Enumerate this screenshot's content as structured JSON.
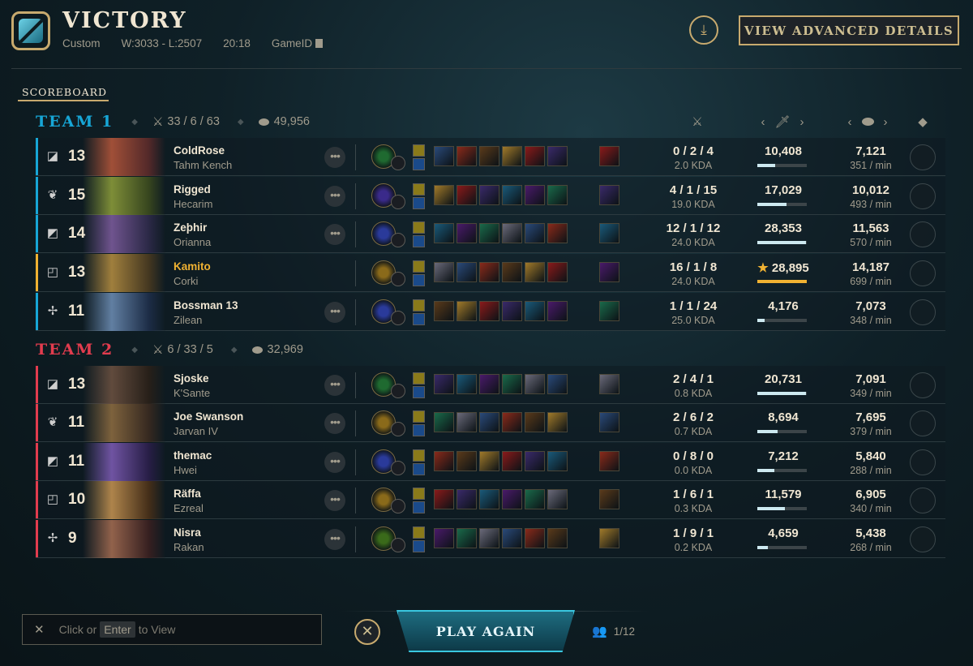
{
  "header": {
    "title": "VICTORY",
    "mode": "Custom",
    "record": "W:3033 - L:2507",
    "duration": "20:18",
    "gameid_label": "GameID",
    "advanced_button": "VIEW ADVANCED DETAILS"
  },
  "scoreboard_label": "SCOREBOARD",
  "teams": [
    {
      "name": "TEAM 1",
      "kills": "33 / 6 / 63",
      "gold": "49,956",
      "color": "#17a6d6",
      "players": [
        {
          "level": "13",
          "name": "ColdRose",
          "champion": "Tahm Kench",
          "kda": "0 / 2 / 4",
          "kda_ratio": "2.0 KDA",
          "damage": "10,408",
          "damage_fill": 0.36,
          "gold": "7,121",
          "gpm": "351 / min",
          "highlight": false,
          "role": "top-icon"
        },
        {
          "level": "15",
          "name": "Rigged",
          "champion": "Hecarim",
          "kda": "4 / 1 / 15",
          "kda_ratio": "19.0 KDA",
          "damage": "17,029",
          "damage_fill": 0.59,
          "gold": "10,012",
          "gpm": "493 / min",
          "highlight": false,
          "role": "jungle-icon"
        },
        {
          "level": "14",
          "name": "Zeþhir",
          "champion": "Orianna",
          "kda": "12 / 1 / 12",
          "kda_ratio": "24.0 KDA",
          "damage": "28,353",
          "damage_fill": 0.98,
          "gold": "11,563",
          "gpm": "570 / min",
          "highlight": false,
          "role": "mid-icon"
        },
        {
          "level": "13",
          "name": "Kamito",
          "champion": "Corki",
          "kda": "16 / 1 / 8",
          "kda_ratio": "24.0 KDA",
          "damage": "28,895",
          "damage_fill": 1.0,
          "gold": "14,187",
          "gpm": "699 / min",
          "highlight": true,
          "role": "bottom-icon"
        },
        {
          "level": "11",
          "name": "Bossman 13",
          "champion": "Zilean",
          "kda": "1 / 1 / 24",
          "kda_ratio": "25.0 KDA",
          "damage": "4,176",
          "damage_fill": 0.15,
          "gold": "7,073",
          "gpm": "348 / min",
          "highlight": false,
          "role": "support-icon"
        }
      ]
    },
    {
      "name": "TEAM 2",
      "kills": "6 / 33 / 5",
      "gold": "32,969",
      "color": "#e23c4e",
      "players": [
        {
          "level": "13",
          "name": "Sjoske",
          "champion": "K'Sante",
          "kda": "2 / 4 / 1",
          "kda_ratio": "0.8 KDA",
          "damage": "20,731",
          "damage_fill": 0.98,
          "gold": "7,091",
          "gpm": "349 / min",
          "highlight": false,
          "role": "top-icon"
        },
        {
          "level": "11",
          "name": "Joe Swanson",
          "champion": "Jarvan IV",
          "kda": "2 / 6 / 2",
          "kda_ratio": "0.7 KDA",
          "damage": "8,694",
          "damage_fill": 0.41,
          "gold": "7,695",
          "gpm": "379 / min",
          "highlight": false,
          "role": "jungle-icon"
        },
        {
          "level": "11",
          "name": "themac",
          "champion": "Hwei",
          "kda": "0 / 8 / 0",
          "kda_ratio": "0.0 KDA",
          "damage": "7,212",
          "damage_fill": 0.34,
          "gold": "5,840",
          "gpm": "288 / min",
          "highlight": false,
          "role": "mid-icon"
        },
        {
          "level": "10",
          "name": "Räffa",
          "champion": "Ezreal",
          "kda": "1 / 6 / 1",
          "kda_ratio": "0.3 KDA",
          "damage": "11,579",
          "damage_fill": 0.55,
          "gold": "6,905",
          "gpm": "340 / min",
          "highlight": false,
          "role": "bottom-icon"
        },
        {
          "level": "9",
          "name": "Nisra",
          "champion": "Rakan",
          "kda": "1 / 9 / 1",
          "kda_ratio": "0.2 KDA",
          "damage": "4,659",
          "damage_fill": 0.22,
          "gold": "5,438",
          "gpm": "268 / min",
          "highlight": false,
          "role": "support-icon"
        }
      ]
    }
  ],
  "footer": {
    "chat_prefix": "Click or",
    "chat_key": "Enter",
    "chat_suffix": "to View",
    "play_again": "PLAY AGAIN",
    "lobby_count": "1/12"
  },
  "colors": {
    "gold_accent": "#c8aa6e",
    "team1": "#17a6d6",
    "team2": "#e23c4e",
    "highlight_name": "#f0b232"
  }
}
